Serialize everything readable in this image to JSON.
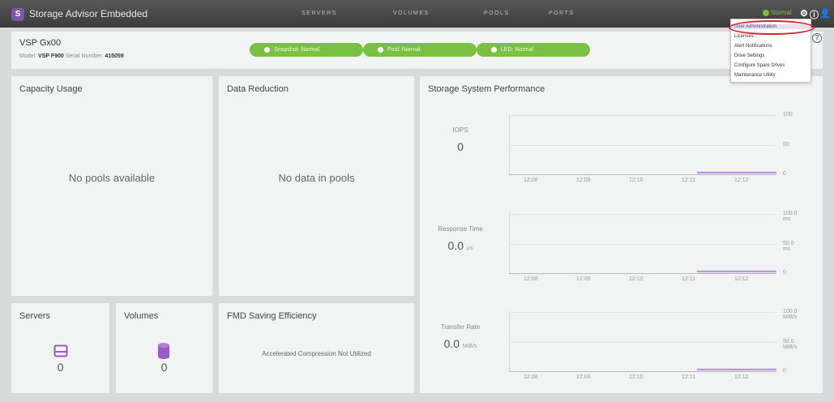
{
  "app": {
    "title": "Storage Advisor Embedded",
    "logo": "S"
  },
  "nav": [
    "SERVERS",
    "VOLUMES",
    "POOLS",
    "PORTS"
  ],
  "header": {
    "status": "Normal"
  },
  "menu": {
    "items": [
      "User Administration",
      "Licenses",
      "Alert Notifications",
      "Drive Settings",
      "Configure Spare Drives",
      "Maintenance Utility"
    ]
  },
  "system": {
    "name": "VSP Gx00",
    "model_label": "Model:",
    "model": "VSP F900",
    "serial_label": "Serial Number:",
    "serial": "415059",
    "statuses": [
      "Snapshot: Normal",
      "Pool: Normal",
      "LED: Normal"
    ]
  },
  "capacity": {
    "title": "Capacity Usage",
    "empty": "No pools available"
  },
  "reduction": {
    "title": "Data Reduction",
    "empty": "No data in pools"
  },
  "servers": {
    "title": "Servers",
    "count": "0"
  },
  "volumes": {
    "title": "Volumes",
    "count": "0"
  },
  "fmd": {
    "title": "FMD Saving Efficiency",
    "message": "Accelerated Compression Not Utilized"
  },
  "performance": {
    "title": "Storage System Performance",
    "metrics": [
      {
        "label": "IOPS",
        "value": "0",
        "unit": "",
        "yticks": [
          "100",
          "50",
          "0"
        ],
        "xticks": [
          "12:08",
          "12:09",
          "12:10",
          "12:11",
          "12:12"
        ]
      },
      {
        "label": "Response Time",
        "value": "0.0",
        "unit": "µs",
        "yticks": [
          "100.0 ms",
          "50.0 ms",
          "0"
        ],
        "xticks": [
          "12:08",
          "12:09",
          "12:10",
          "12:11",
          "12:12"
        ]
      },
      {
        "label": "Transfer Rate",
        "value": "0.0",
        "unit": "MiB/s",
        "yticks": [
          "100.0 MiB/s",
          "50.0 MiB/s",
          "0"
        ],
        "xticks": [
          "12:08",
          "12:09",
          "12:10",
          "12:11",
          "12:12"
        ]
      }
    ]
  },
  "colors": {
    "accent": "#7d56a8",
    "ok": "#79c043",
    "highlight": "#d2232a"
  },
  "icons": {
    "servers": "server-drive-icon",
    "volumes": "volume-cylinder-icon"
  }
}
